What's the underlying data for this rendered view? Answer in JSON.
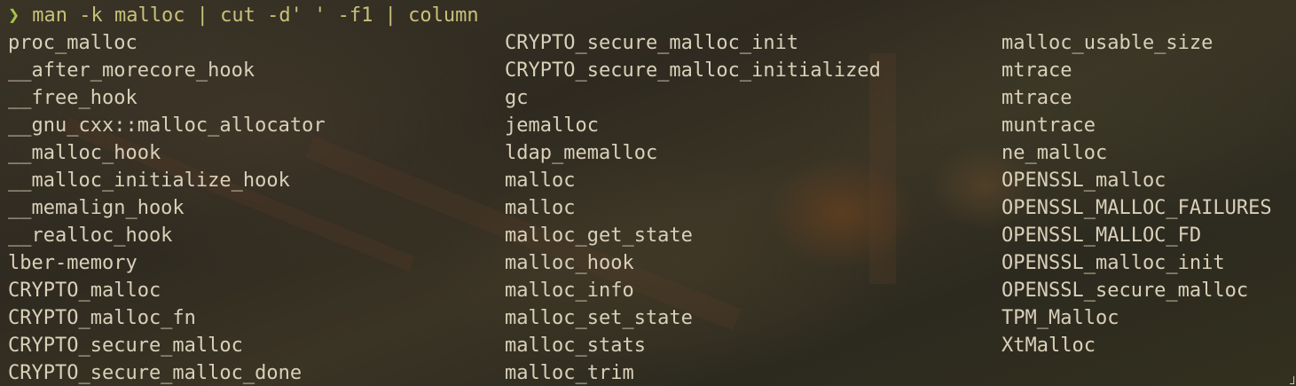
{
  "terminal": {
    "prompt_symbol": "❯",
    "command": "man -k malloc | cut -d' ' -f1 | column",
    "colors": {
      "prompt": "#a8c24a",
      "command": "#c9c07a",
      "output": "#d9d0b9"
    },
    "output_columns": [
      [
        "proc_malloc",
        "__after_morecore_hook",
        "__free_hook",
        "__gnu_cxx::malloc_allocator",
        "__malloc_hook",
        "__malloc_initialize_hook",
        "__memalign_hook",
        "__realloc_hook",
        "lber-memory",
        "CRYPTO_malloc",
        "CRYPTO_malloc_fn",
        "CRYPTO_secure_malloc",
        "CRYPTO_secure_malloc_done"
      ],
      [
        "CRYPTO_secure_malloc_init",
        "CRYPTO_secure_malloc_initialized",
        "gc",
        "jemalloc",
        "ldap_memalloc",
        "malloc",
        "malloc",
        "malloc_get_state",
        "malloc_hook",
        "malloc_info",
        "malloc_set_state",
        "malloc_stats",
        "malloc_trim"
      ],
      [
        "malloc_usable_size",
        "mtrace",
        "mtrace",
        "muntrace",
        "ne_malloc",
        "OPENSSL_malloc",
        "OPENSSL_MALLOC_FAILURES",
        "OPENSSL_MALLOC_FD",
        "OPENSSL_malloc_init",
        "OPENSSL_secure_malloc",
        "TPM_Malloc",
        "XtMalloc"
      ]
    ]
  }
}
